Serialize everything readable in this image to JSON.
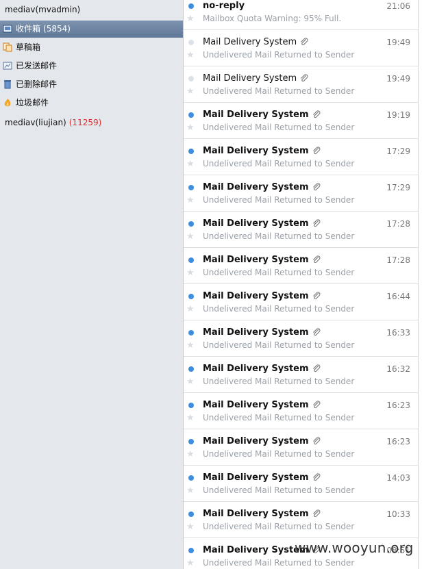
{
  "accounts": [
    {
      "name": "mediav(mvadmin)"
    },
    {
      "name": "mediav(liujian)",
      "count": "(11259)"
    }
  ],
  "folders": [
    {
      "label": "收件箱",
      "count": "(5854)",
      "icon": "inbox-icon",
      "selected": true
    },
    {
      "label": "草稿箱",
      "count": "",
      "icon": "drafts-icon",
      "selected": false
    },
    {
      "label": "已发送邮件",
      "count": "",
      "icon": "sent-icon",
      "selected": false
    },
    {
      "label": "已删除邮件",
      "count": "",
      "icon": "trash-icon",
      "selected": false
    },
    {
      "label": "垃圾邮件",
      "count": "",
      "icon": "junk-icon",
      "selected": false
    }
  ],
  "colors": {
    "unread_dot": "#3e8ee0",
    "read_dot": "#dde2e8",
    "count_red": "#e02a2a",
    "selected_folder": "#6a82a3"
  },
  "messages": [
    {
      "sender": "no-reply",
      "time": "21:06",
      "subject": "Mailbox Quota Warning: 95% Full.",
      "unread": true,
      "attachment": false
    },
    {
      "sender": "Mail Delivery System",
      "time": "19:49",
      "subject": "Undelivered Mail Returned to Sender",
      "unread": false,
      "attachment": true
    },
    {
      "sender": "Mail Delivery System",
      "time": "19:49",
      "subject": "Undelivered Mail Returned to Sender",
      "unread": false,
      "attachment": true
    },
    {
      "sender": "Mail Delivery System",
      "time": "19:19",
      "subject": "Undelivered Mail Returned to Sender",
      "unread": true,
      "attachment": true
    },
    {
      "sender": "Mail Delivery System",
      "time": "17:29",
      "subject": "Undelivered Mail Returned to Sender",
      "unread": true,
      "attachment": true
    },
    {
      "sender": "Mail Delivery System",
      "time": "17:29",
      "subject": "Undelivered Mail Returned to Sender",
      "unread": true,
      "attachment": true
    },
    {
      "sender": "Mail Delivery System",
      "time": "17:28",
      "subject": "Undelivered Mail Returned to Sender",
      "unread": true,
      "attachment": true
    },
    {
      "sender": "Mail Delivery System",
      "time": "17:28",
      "subject": "Undelivered Mail Returned to Sender",
      "unread": true,
      "attachment": true
    },
    {
      "sender": "Mail Delivery System",
      "time": "16:44",
      "subject": "Undelivered Mail Returned to Sender",
      "unread": true,
      "attachment": true
    },
    {
      "sender": "Mail Delivery System",
      "time": "16:33",
      "subject": "Undelivered Mail Returned to Sender",
      "unread": true,
      "attachment": true
    },
    {
      "sender": "Mail Delivery System",
      "time": "16:32",
      "subject": "Undelivered Mail Returned to Sender",
      "unread": true,
      "attachment": true
    },
    {
      "sender": "Mail Delivery System",
      "time": "16:23",
      "subject": "Undelivered Mail Returned to Sender",
      "unread": true,
      "attachment": true
    },
    {
      "sender": "Mail Delivery System",
      "time": "16:23",
      "subject": "Undelivered Mail Returned to Sender",
      "unread": true,
      "attachment": true
    },
    {
      "sender": "Mail Delivery System",
      "time": "14:03",
      "subject": "Undelivered Mail Returned to Sender",
      "unread": true,
      "attachment": true
    },
    {
      "sender": "Mail Delivery System",
      "time": "10:33",
      "subject": "Undelivered Mail Returned to Sender",
      "unread": true,
      "attachment": true
    },
    {
      "sender": "Mail Delivery System",
      "time": "08:51",
      "subject": "Undelivered Mail Returned to Sender",
      "unread": true,
      "attachment": true
    }
  ],
  "watermark": "www.wooyun.org"
}
